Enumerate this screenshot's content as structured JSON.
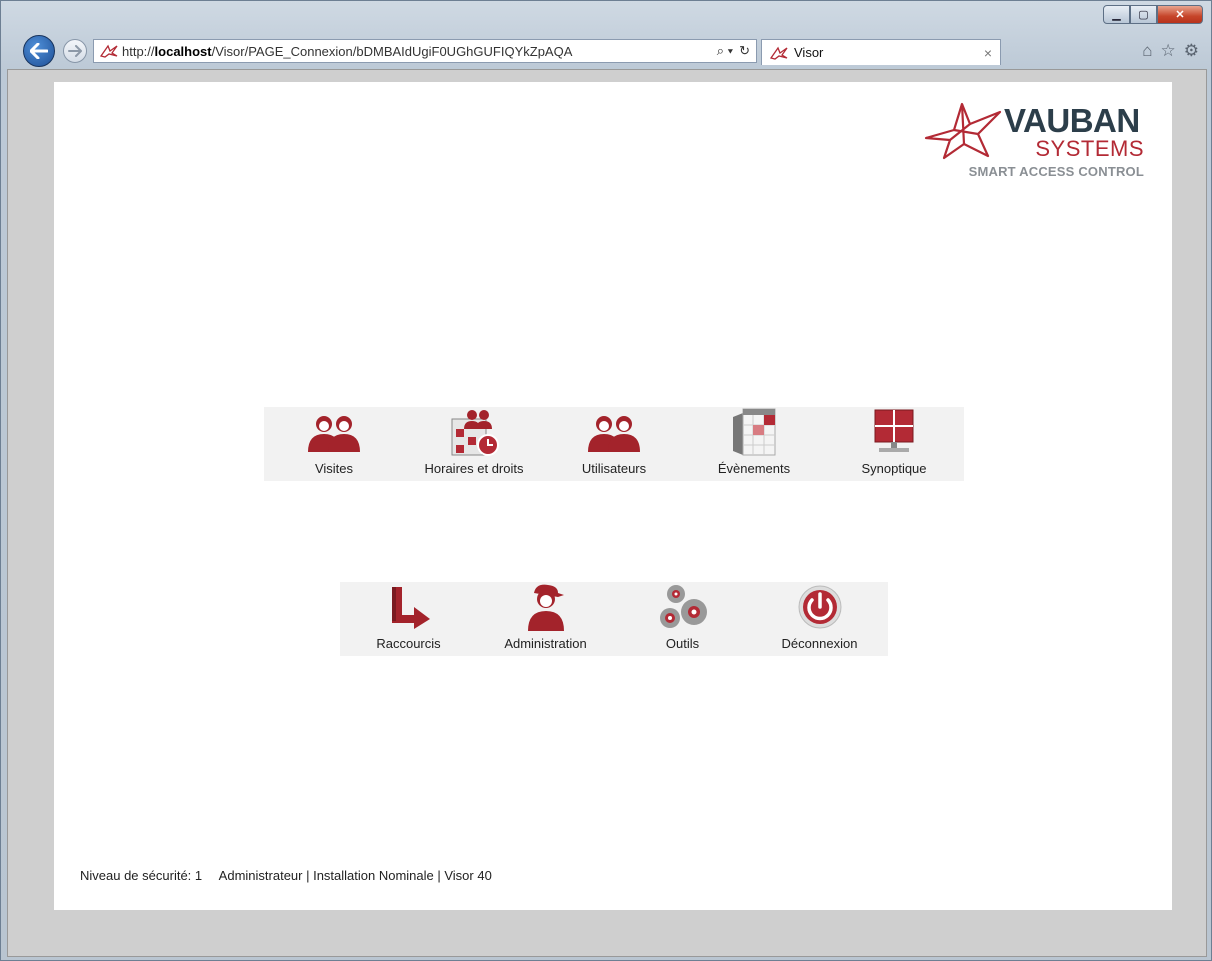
{
  "browser": {
    "url_prefix": "http://",
    "url_host": "localhost",
    "url_path": "/Visor/PAGE_Connexion/bDMBAIdUgiF0UGhGUFIQYkZpAQA",
    "tab_title": "Visor",
    "search_glyph": "⌕ ▾",
    "refresh_glyph": "↻",
    "tab_close": "×",
    "caption": {
      "minimize": "▁",
      "maximize": "▢",
      "close": "✕"
    },
    "icons": {
      "home": "⌂",
      "favorites": "☆",
      "settings": "⚙"
    }
  },
  "logo": {
    "brand": "VAUBAN",
    "sub": "SYSTEMS",
    "tagline": "SMART ACCESS CONTROL"
  },
  "menu_row1": [
    {
      "label": "Visites",
      "icon": "users-icon"
    },
    {
      "label": "Horaires et droits",
      "icon": "schedule-rights-icon"
    },
    {
      "label": "Utilisateurs",
      "icon": "users-icon"
    },
    {
      "label": "Évènements",
      "icon": "events-calendar-icon"
    },
    {
      "label": "Synoptique",
      "icon": "synoptic-monitor-icon"
    }
  ],
  "menu_row2": [
    {
      "label": "Raccourcis",
      "icon": "shortcut-arrow-icon"
    },
    {
      "label": "Administration",
      "icon": "admin-user-icon"
    },
    {
      "label": "Outils",
      "icon": "gears-icon"
    },
    {
      "label": "Déconnexion",
      "icon": "power-icon"
    }
  ],
  "footer": {
    "security_label": "Niveau de sécurité:",
    "security_value": "1",
    "status": "Administrateur | Installation Nominale | Visor 40"
  },
  "colors": {
    "accent": "#b32a35",
    "brand_dark": "#2c3e4a",
    "menu_bg": "#f2f2f2"
  }
}
